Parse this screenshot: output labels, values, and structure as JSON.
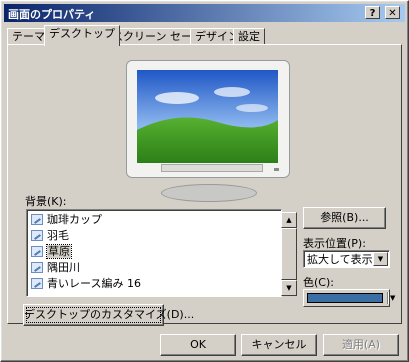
{
  "window": {
    "title": "画面のプロパティ",
    "help_glyph": "?",
    "close_glyph": "✕"
  },
  "tabs": [
    {
      "label": "テーマ",
      "active": false
    },
    {
      "label": "デスクトップ",
      "active": true
    },
    {
      "label": "スクリーン セーバー",
      "active": false
    },
    {
      "label": "デザイン",
      "active": false
    },
    {
      "label": "設定",
      "active": false
    }
  ],
  "desktop": {
    "background_label": "背景(K):",
    "backgrounds": [
      "珈琲カップ",
      "羽毛",
      "草原",
      "隅田川",
      "青いレース編み 16"
    ],
    "selected_background": "草原",
    "browse_button": "参照(B)...",
    "position_label": "表示位置(P):",
    "position_value": "拡大して表示",
    "color_label": "色(C):",
    "color_value": "#3a6ea5",
    "customize_button": "デスクトップのカスタマイズ(D)..."
  },
  "footer": {
    "ok": "OK",
    "cancel": "キャンセル",
    "apply": "適用(A)"
  },
  "icons": {
    "help": "help-icon",
    "close": "close-icon",
    "scroll_up": "▲",
    "scroll_down": "▼",
    "dropdown": "▼"
  }
}
